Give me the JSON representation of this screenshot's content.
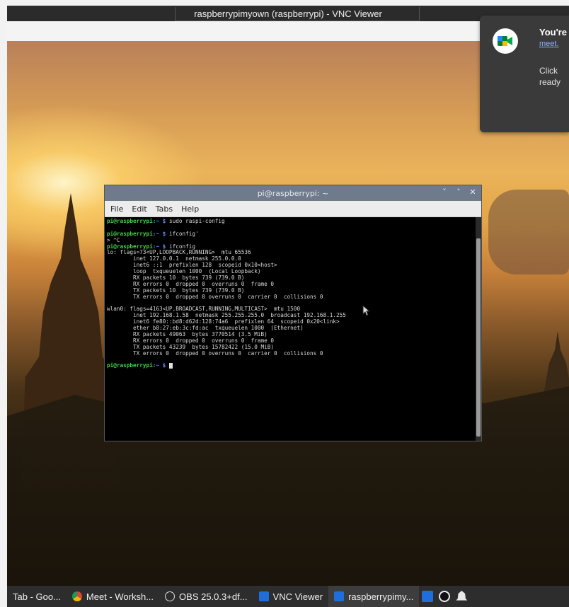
{
  "window": {
    "title": "raspberrypimyown (raspberrypi) - VNC Viewer"
  },
  "notification": {
    "title": "You're",
    "link": "meet.",
    "body": "Click\nready",
    "icon": "google-meet-icon"
  },
  "terminal": {
    "title": "pi@raspberrypi: ~",
    "controls": [
      "˅",
      "˄",
      "✕"
    ],
    "menu": [
      "File",
      "Edit",
      "Tabs",
      "Help"
    ],
    "lines": [
      {
        "prompt": "pi@raspberrypi",
        "path": ":~ $",
        "text": " sudo raspi-config"
      },
      {
        "text": ""
      },
      {
        "prompt": "pi@raspberrypi",
        "path": ":~ $",
        "text": " ifconfig'"
      },
      {
        "text": "> ^C"
      },
      {
        "prompt": "pi@raspberrypi",
        "path": ":~ $",
        "text": " ifconfig"
      },
      {
        "text": "lo: flags=73<UP,LOOPBACK,RUNNING>  mtu 65536"
      },
      {
        "text": "        inet 127.0.0.1  netmask 255.0.0.0"
      },
      {
        "text": "        inet6 ::1  prefixlen 128  scopeid 0x10<host>"
      },
      {
        "text": "        loop  txqueuelen 1000  (Local Loopback)"
      },
      {
        "text": "        RX packets 10  bytes 739 (739.0 B)"
      },
      {
        "text": "        RX errors 0  dropped 0  overruns 0  frame 0"
      },
      {
        "text": "        TX packets 10  bytes 739 (739.0 B)"
      },
      {
        "text": "        TX errors 0  dropped 0 overruns 0  carrier 0  collisions 0"
      },
      {
        "text": ""
      },
      {
        "text": "wlan0: flags=4163<UP,BROADCAST,RUNNING,MULTICAST>  mtu 1500"
      },
      {
        "text": "        inet 192.168.1.58  netmask 255.255.255.0  broadcast 192.168.1.255"
      },
      {
        "text": "        inet6 fe80::bd8:d62d:128:74a6  prefixlen 64  scopeid 0x20<link>"
      },
      {
        "text": "        ether b8:27:eb:3c:fd:ac  txqueuelen 1000  (Ethernet)"
      },
      {
        "text": "        RX packets 49063  bytes 3770514 (3.5 MiB)"
      },
      {
        "text": "        RX errors 0  dropped 0  overruns 0  frame 0"
      },
      {
        "text": "        TX packets 43239  bytes 15782422 (15.0 MiB)"
      },
      {
        "text": "        TX errors 0  dropped 0 overruns 0  carrier 0  collisions 0"
      },
      {
        "text": ""
      },
      {
        "prompt": "pi@raspberrypi",
        "path": ":~ $",
        "text": " ",
        "cursor": true
      }
    ]
  },
  "taskbar": {
    "items": [
      {
        "label": "Tab - Goo...",
        "icon": "chrome-tab-icon",
        "color": "#2d2d2d"
      },
      {
        "label": "Meet - Worksh...",
        "icon": "chrome-icon",
        "color": "#e8a33a"
      },
      {
        "label": "OBS 25.0.3+df...",
        "icon": "obs-icon",
        "color": "#2d2d2d"
      },
      {
        "label": "VNC Viewer",
        "icon": "vnc-icon",
        "color": "#1e6fd9"
      },
      {
        "label": "raspberrypimy...",
        "icon": "vnc-icon",
        "color": "#1e6fd9",
        "active": true
      }
    ],
    "system_icons": [
      "vnc-tray-icon",
      "obs-tray-icon",
      "notification-bell-icon"
    ]
  }
}
